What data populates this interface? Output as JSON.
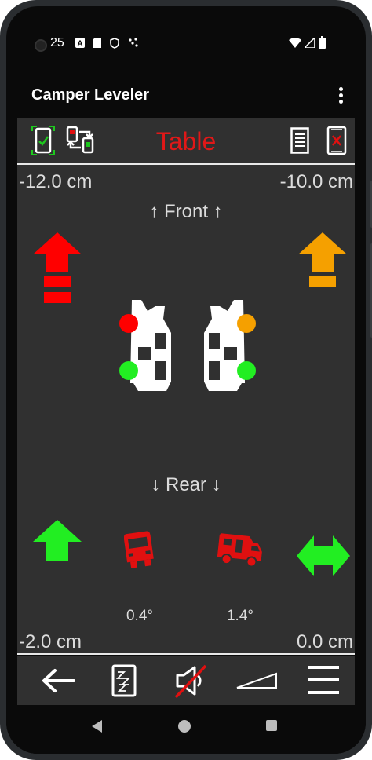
{
  "status_bar": {
    "time": "25"
  },
  "app_bar": {
    "title": "Camper Leveler"
  },
  "toolbar": {
    "mode_title": "Table",
    "mode_color": "#e01818"
  },
  "corners": {
    "front_left": "-12.0 cm",
    "front_right": "-10.0 cm",
    "rear_left": "-2.0 cm",
    "rear_right": "0.0 cm"
  },
  "labels": {
    "front": "↑ Front ↑",
    "rear": "↓ Rear ↓"
  },
  "angles": {
    "roll": "0.4°",
    "pitch": "1.4°"
  },
  "colors": {
    "red": "#ff0000",
    "orange": "#f5a000",
    "green": "#22ee22",
    "vehicle_red": "#e01010",
    "background": "#303030"
  },
  "icons": {
    "calibrate": "tablet-check-icon",
    "switch": "device-swap-icon",
    "notes": "document-icon",
    "device": "tablet-x-icon",
    "back": "arrow-left-icon",
    "sleep": "sleep-zzz-icon",
    "sound": "speaker-muted-icon",
    "ramp": "ramp-icon",
    "menu": "hamburger-menu-icon"
  }
}
